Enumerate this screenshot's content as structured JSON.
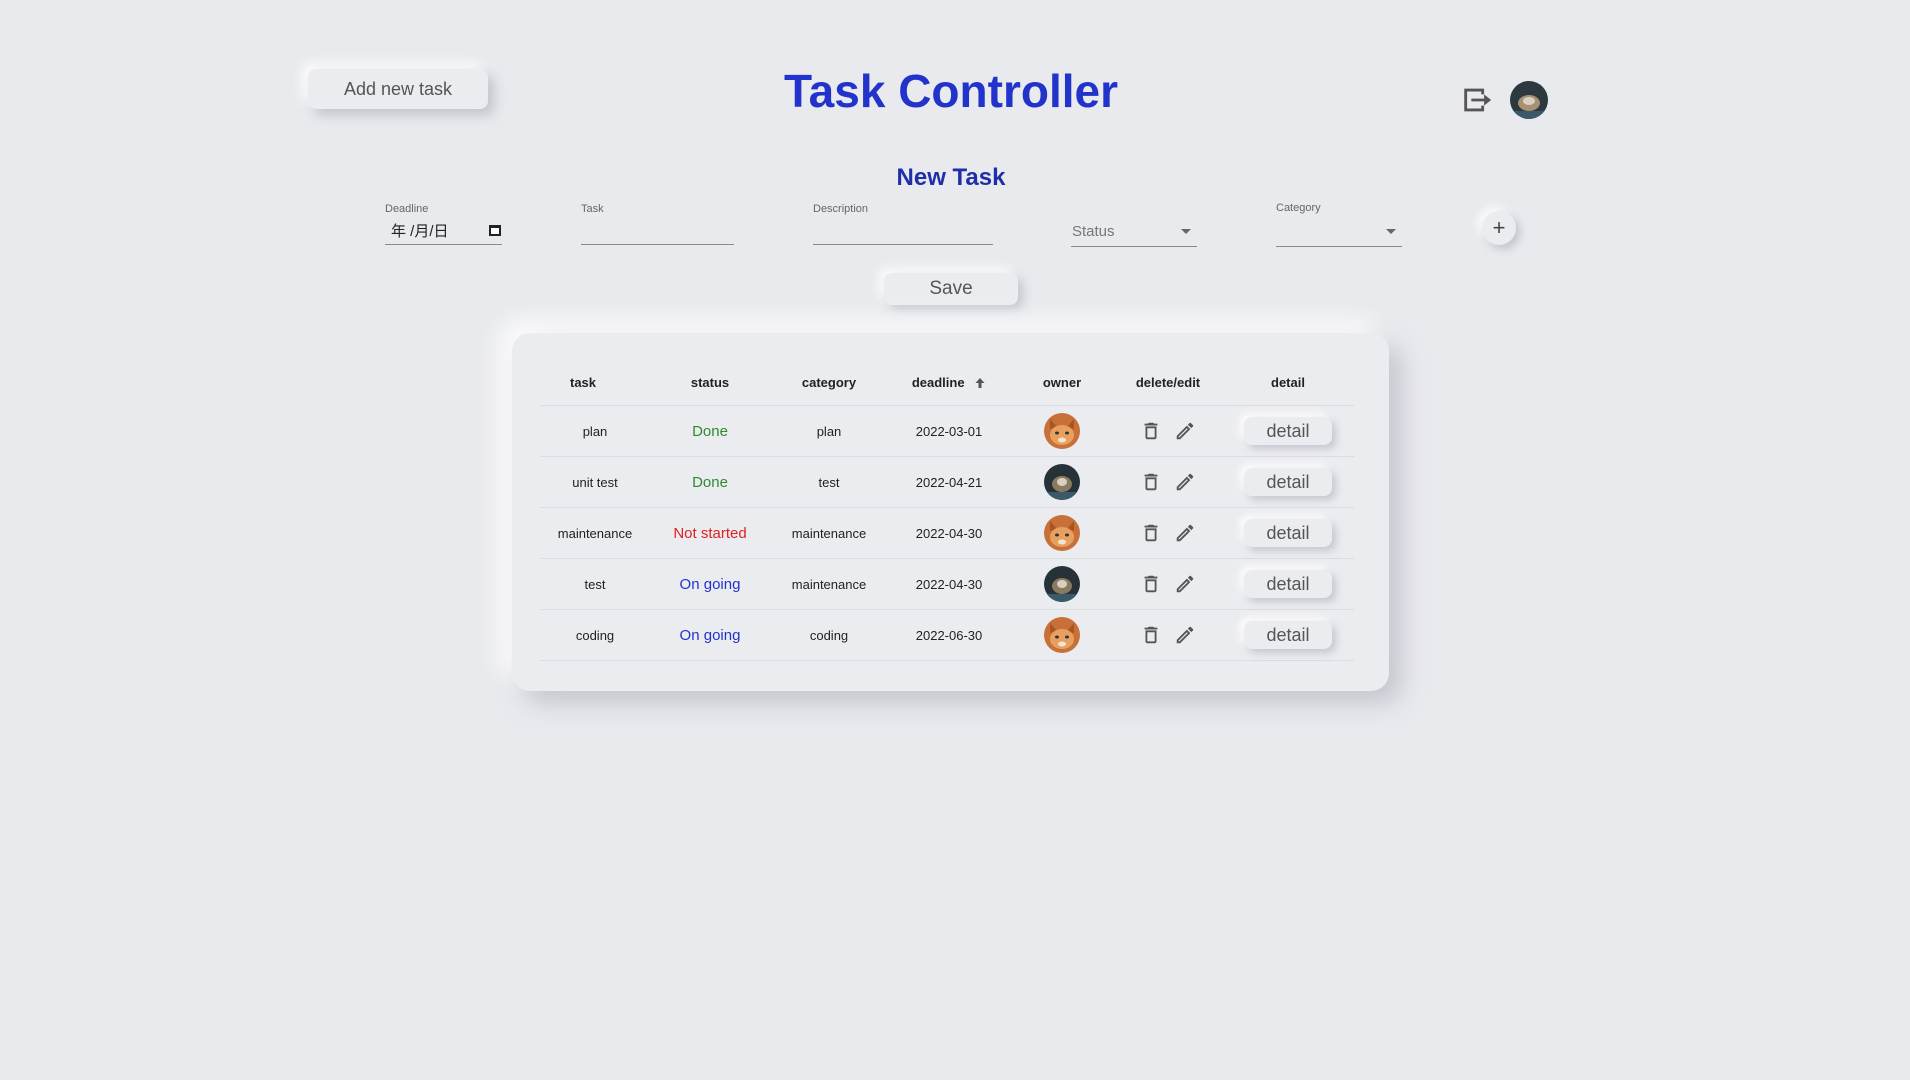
{
  "header": {
    "add_task_label": "Add new task",
    "title": "Task Controller",
    "logout_icon": "logout-icon",
    "avatar_icon": "user-avatar"
  },
  "form": {
    "title": "New Task",
    "deadline": {
      "label": "Deadline",
      "value": "年 /月/日"
    },
    "task": {
      "label": "Task",
      "value": ""
    },
    "description": {
      "label": "Description",
      "value": ""
    },
    "status": {
      "placeholder": "Status",
      "value": ""
    },
    "category": {
      "label": "Category",
      "value": ""
    },
    "add_icon_text": "+",
    "save_label": "Save"
  },
  "table": {
    "columns": {
      "task": "task",
      "status": "status",
      "category": "category",
      "deadline": "deadline",
      "owner": "owner",
      "delete_edit": "delete/edit",
      "detail": "detail"
    },
    "sort": {
      "column": "deadline",
      "direction": "ascending"
    },
    "rows": [
      {
        "task": "plan",
        "status": "Done",
        "status_color": "#2e8b2e",
        "category": "plan",
        "deadline": "2022-03-01",
        "owner_avatar": "cat",
        "detail_label": "detail"
      },
      {
        "task": "unit test",
        "status": "Done",
        "status_color": "#2e8b2e",
        "category": "test",
        "deadline": "2022-04-21",
        "owner_avatar": "dark",
        "detail_label": "detail"
      },
      {
        "task": "maintenance",
        "status": "Not started",
        "status_color": "#e02020",
        "category": "maintenance",
        "deadline": "2022-04-30",
        "owner_avatar": "cat",
        "detail_label": "detail"
      },
      {
        "task": "test",
        "status": "On going",
        "status_color": "#2233cc",
        "category": "maintenance",
        "deadline": "2022-04-30",
        "owner_avatar": "dark",
        "detail_label": "detail"
      },
      {
        "task": "coding",
        "status": "On going",
        "status_color": "#2233cc",
        "category": "coding",
        "deadline": "2022-06-30",
        "owner_avatar": "cat",
        "detail_label": "detail"
      }
    ]
  },
  "colors": {
    "background": "#e9eaee",
    "title": "#2233cc",
    "form_title": "#1f2fa8",
    "done": "#2e8b2e",
    "not_started": "#e02020",
    "on_going": "#2233cc"
  }
}
